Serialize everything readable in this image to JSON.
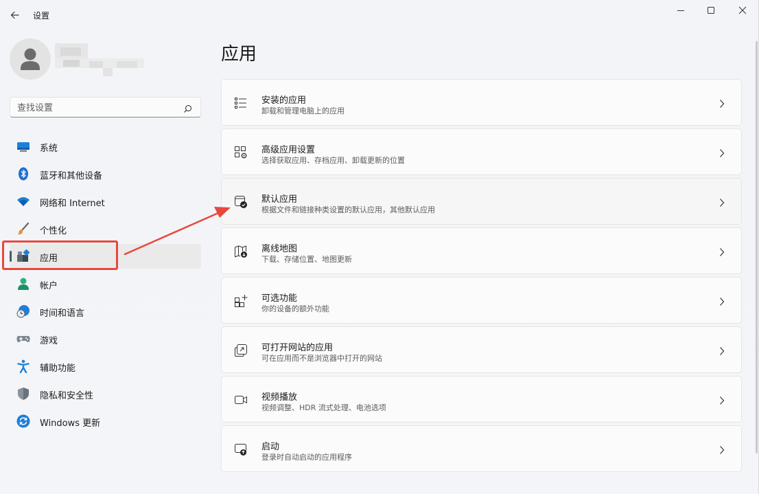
{
  "window": {
    "title": "设置",
    "back_icon": "back-arrow-icon",
    "controls": [
      "minimize-icon",
      "maximize-icon",
      "close-icon"
    ]
  },
  "profile": {
    "avatar_icon": "user-avatar-icon"
  },
  "search": {
    "placeholder": "查找设置",
    "icon": "search-icon"
  },
  "sidebar": {
    "items": [
      {
        "label": "系统",
        "icon": "system-display-icon"
      },
      {
        "label": "蓝牙和其他设备",
        "icon": "bluetooth-icon"
      },
      {
        "label": "网络和 Internet",
        "icon": "wifi-icon"
      },
      {
        "label": "个性化",
        "icon": "brush-icon"
      },
      {
        "label": "应用",
        "icon": "apps-icon",
        "selected": true
      },
      {
        "label": "帐户",
        "icon": "account-icon"
      },
      {
        "label": "时间和语言",
        "icon": "time-language-icon"
      },
      {
        "label": "游戏",
        "icon": "gamepad-icon"
      },
      {
        "label": "辅助功能",
        "icon": "accessibility-icon"
      },
      {
        "label": "隐私和安全性",
        "icon": "shield-icon"
      },
      {
        "label": "Windows 更新",
        "icon": "windows-update-icon"
      }
    ]
  },
  "main": {
    "title": "应用",
    "cards": [
      {
        "title": "安装的应用",
        "subtitle": "卸载和管理电脑上的应用",
        "icon": "list-icon"
      },
      {
        "title": "高级应用设置",
        "subtitle": "选择获取应用、存档应用、卸载更新的位置",
        "icon": "app-settings-icon"
      },
      {
        "title": "默认应用",
        "subtitle": "根据文件和链接种类设置的默认应用，其他默认应用",
        "icon": "default-apps-icon"
      },
      {
        "title": "离线地图",
        "subtitle": "下载、存储位置、地图更新",
        "icon": "offline-map-icon"
      },
      {
        "title": "可选功能",
        "subtitle": "你的设备的额外功能",
        "icon": "optional-features-icon"
      },
      {
        "title": "可打开网站的应用",
        "subtitle": "可在应用而不是浏览器中打开的网站",
        "icon": "open-website-icon"
      },
      {
        "title": "视频播放",
        "subtitle": "视频调整、HDR 流式处理、电池选项",
        "icon": "video-camera-icon"
      },
      {
        "title": "启动",
        "subtitle": "登录时自动启动的应用程序",
        "icon": "startup-icon"
      }
    ]
  },
  "colors": {
    "accent": "#0067c0",
    "annotation": "#e8473d"
  }
}
